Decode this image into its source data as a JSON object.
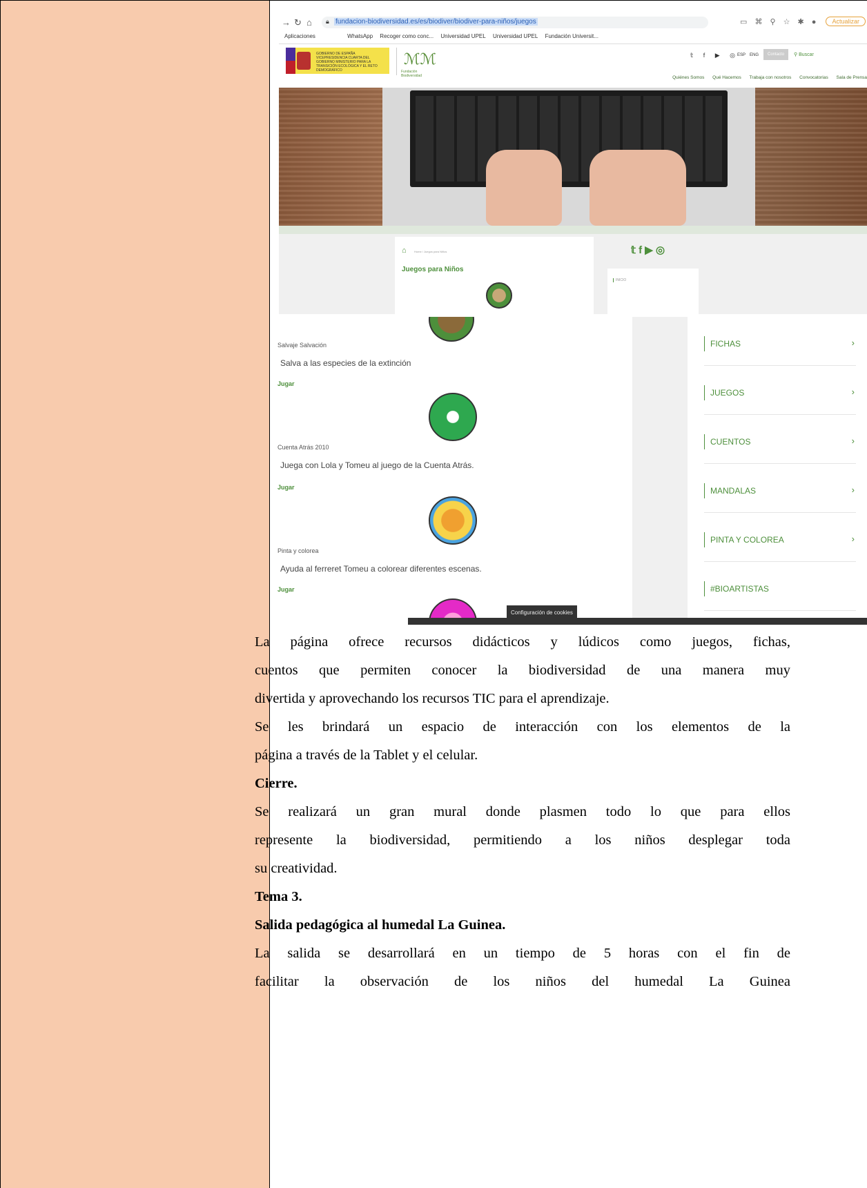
{
  "browser": {
    "url": "fundacion-biodiversidad.es/es/biodiver/biodiver-para-niños/juegos",
    "update_label": "Actualizar",
    "bookmarks": [
      "Aplicaciones",
      "WhatsApp",
      "Recoger como conc...",
      "Universidad UPEL",
      "Universidad UPEL",
      "Fundación Universit..."
    ]
  },
  "site": {
    "gov_text": "VICEPRESIDENCIA CUARTA DEL GOBIERNO MINISTERIO PARA LA TRANSICIÓN ECOLÓGICA Y EL RETO DEMOGRÁFICO",
    "gov_label": "GOBIERNO DE ESPAÑA",
    "foundation_name": "Fundación Biodiversidad",
    "lang_esp": "ESP",
    "lang_eng": "ENG",
    "contact_label": "Contacto",
    "search_label": "Buscar",
    "menu": [
      "Quiénes Somos",
      "Qué Hacemos",
      "Trabaja con nosotros",
      "Convocatorias",
      "Sala de Prensa"
    ],
    "breadcrumb": "Home / Juegos para Niños",
    "page_title": "Juegos para Niños",
    "side_first": "INICIO"
  },
  "games": [
    {
      "name": "Salvaje Salvación",
      "desc": "Salva a las especies de la extinción",
      "play": "Jugar"
    },
    {
      "name": "Cuenta Atrás 2010",
      "desc": "Juega con Lola y Tomeu al juego de la Cuenta Atrás.",
      "play": "Jugar"
    },
    {
      "name": "Pinta y colorea",
      "desc": "Ayuda al ferreret Tomeu a colorear diferentes escenas.",
      "play": "Jugar"
    }
  ],
  "side_menu": [
    "FICHAS",
    "JUEGOS",
    "CUENTOS",
    "MANDALAS",
    "PINTA Y COLOREA",
    "#BIOARTISTAS"
  ],
  "cookie_label": "Configuración de cookies",
  "text": {
    "p1_l1": "La página ofrece recursos didácticos y lúdicos como juegos, fichas,",
    "p1_l2": "cuentos que permiten conocer la biodiversidad de una manera muy",
    "p1_l3": "divertida y aprovechando los recursos TIC para el aprendizaje.",
    "p2_l1": "Se les brindará un espacio de interacción con los elementos de la",
    "p2_l2": "página a través de la Tablet y el celular.",
    "h_cierre": "Cierre.",
    "p3_l1": "Se realizará un gran mural donde plasmen todo lo que para ellos",
    "p3_l2": "represente la biodiversidad, permitiendo a los niños desplegar toda",
    "p3_l3": "su creatividad.",
    "h_tema": "Tema 3.",
    "h_salida": "Salida pedagógica al humedal La Guinea.",
    "p4_l1": "La salida se desarrollará en un tiempo de 5 horas con el fin de",
    "p4_l2": "facilitar la observación de los niños del humedal La Guinea"
  }
}
